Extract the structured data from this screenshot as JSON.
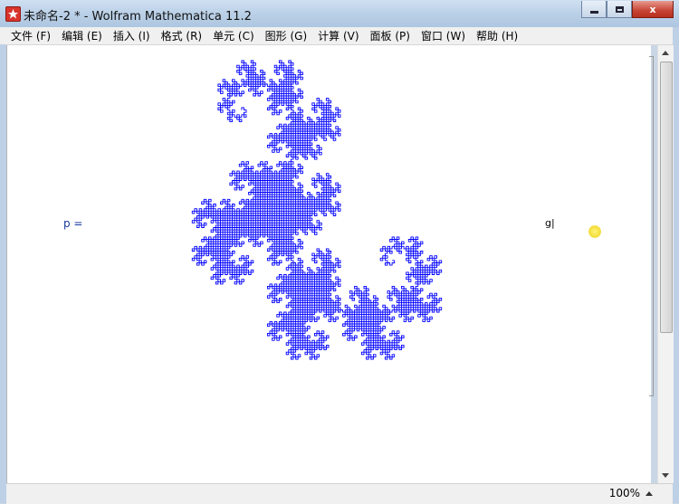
{
  "window": {
    "title": "未命名-2 * - Wolfram Mathematica 11.2",
    "close_label": "x"
  },
  "menu": [
    "文件 (F)",
    "编辑 (E)",
    "插入 (I)",
    "格式 (R)",
    "单元 (C)",
    "图形 (G)",
    "计算 (V)",
    "面板 (P)",
    "窗口 (W)",
    "帮助 (H)"
  ],
  "notebook": {
    "input_label": "p =",
    "cursor_text": "g|",
    "fractal_color": "#0000ff"
  },
  "status": {
    "zoom": "100%"
  }
}
